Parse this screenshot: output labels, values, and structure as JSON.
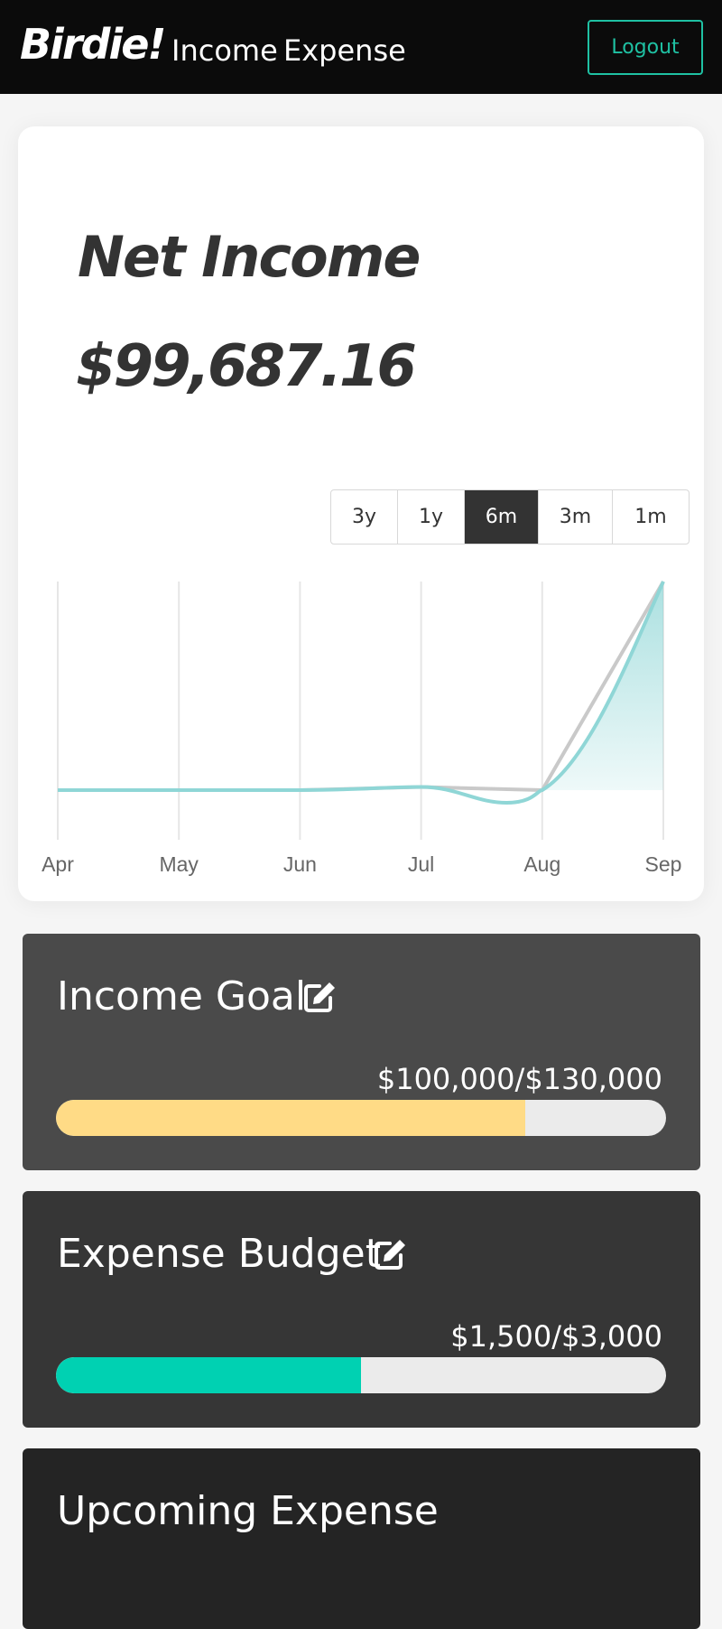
{
  "nav": {
    "brand": "Birdie!",
    "links": [
      "Income",
      "Expense"
    ],
    "logout_label": "Logout"
  },
  "card": {
    "title": "Net Income",
    "amount": "$99,687.16",
    "ranges": [
      "3y",
      "1y",
      "6m",
      "3m",
      "1m"
    ],
    "active_range": "6m"
  },
  "chart_data": {
    "type": "line",
    "title": "",
    "xlabel": "",
    "ylabel": "",
    "categories": [
      "Apr",
      "May",
      "Jun",
      "Jul",
      "Aug",
      "Sep"
    ],
    "grid": "vertical",
    "series": [
      {
        "values": [
          0,
          0,
          0,
          1500,
          0,
          99687
        ],
        "color": "#c9c9c9"
      },
      {
        "values": [
          0,
          0,
          0,
          1500,
          0,
          99687
        ],
        "color": "#8fd6d6",
        "fill": true
      }
    ],
    "ylim": [
      -20000,
      99687
    ]
  },
  "income_goal": {
    "title": "Income Goal",
    "amount": "$100,000/$130,000",
    "current": 100000,
    "target": 130000,
    "color": "#ffdb86",
    "panel_color": "#4a4a4a"
  },
  "expense_budget": {
    "title": "Expense Budget",
    "amount": "$1,500/$3,000",
    "current": 1500,
    "target": 3000,
    "color": "#00d1b2",
    "panel_color": "#363636"
  },
  "upcoming": {
    "title": "Upcoming Expense",
    "panel_color": "#242424"
  }
}
